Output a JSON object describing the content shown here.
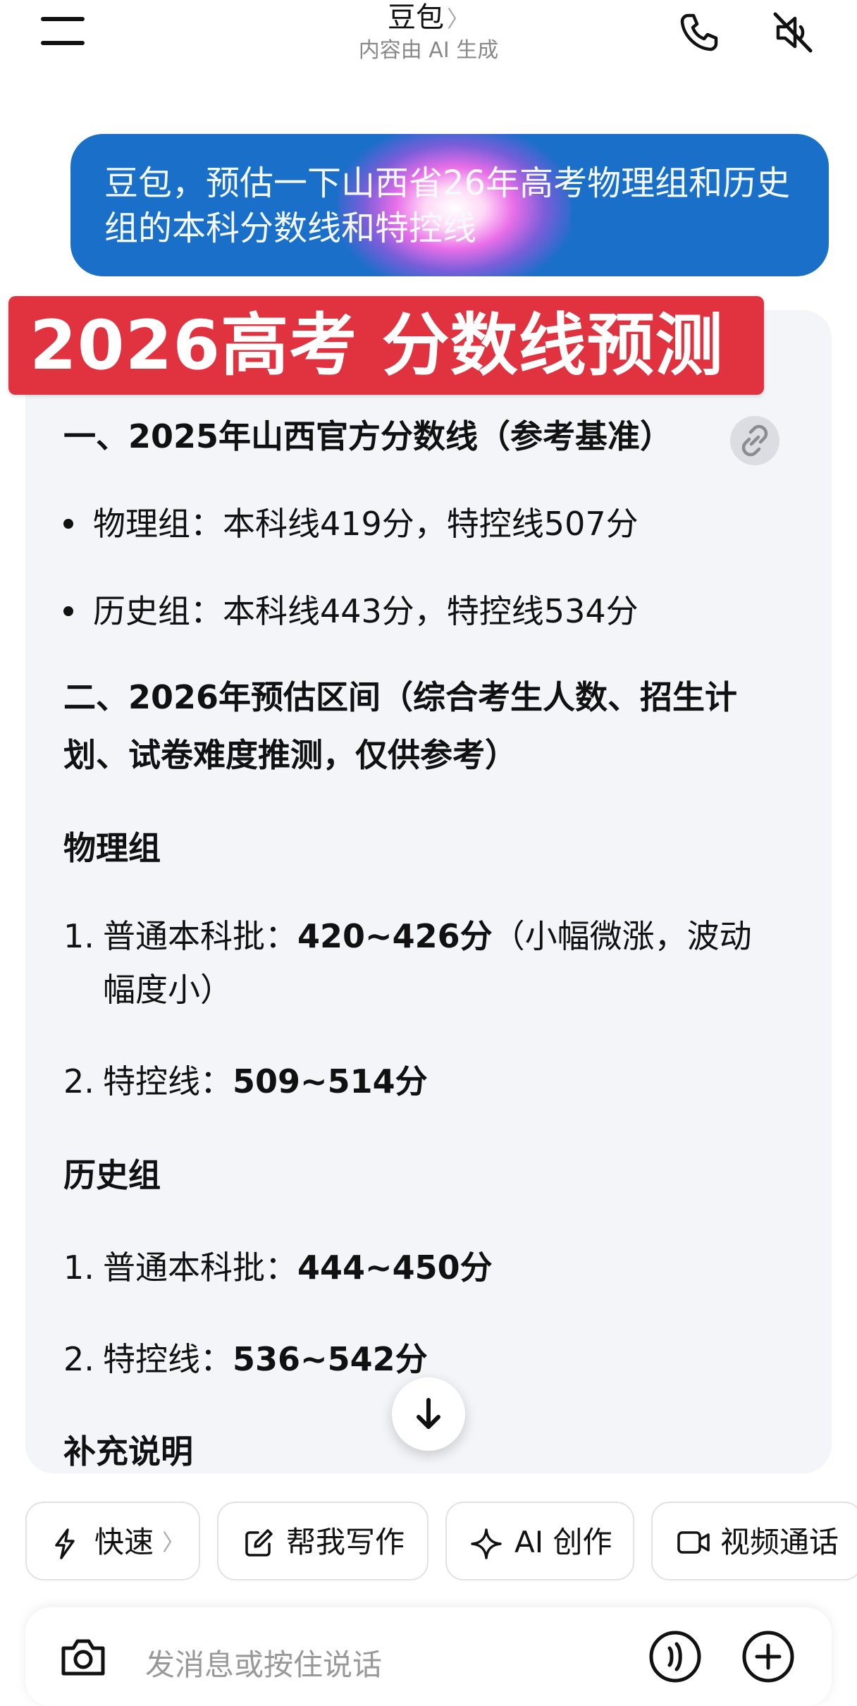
{
  "header": {
    "title": "豆包",
    "title_chevron": "〉",
    "subtitle": "内容由 AI 生成"
  },
  "user_message": {
    "text": "豆包，预估一下山西省26年高考物理组和历史组的本科分数线和特控线"
  },
  "banner": {
    "text": "2026高考  分数线预测"
  },
  "answer": {
    "section1_title": "一、2025年山西官方分数线（参考基准）",
    "bullets": [
      "物理组：本科线419分，特控线507分",
      "历史组：本科线443分，特控线534分"
    ],
    "section2_title": "二、2026年预估区间（综合考生人数、招生计划、试卷难度推测，仅供参考）",
    "physics": {
      "heading": "物理组",
      "items": [
        {
          "num": "1.",
          "label": "普通本科批：",
          "value": "420~426分",
          "note": "（小幅微涨，波动",
          "note2": "幅度小）"
        },
        {
          "num": "2.",
          "label": "特控线：",
          "value": "509~514分"
        }
      ]
    },
    "history": {
      "heading": "历史组",
      "items": [
        {
          "num": "1.",
          "label": "普通本科批：",
          "value": "444~450分"
        },
        {
          "num": "2.",
          "label": "特控线：",
          "value": "536~542分"
        }
      ]
    },
    "supplement_heading": "补充说明"
  },
  "chips": [
    {
      "label": "快速",
      "chevron": "〉",
      "icon": "lightning-icon"
    },
    {
      "label": "帮我写作",
      "icon": "edit-icon"
    },
    {
      "label": "AI 创作",
      "icon": "sparkle-icon"
    },
    {
      "label": "视频通话",
      "icon": "video-icon"
    }
  ],
  "input": {
    "placeholder": "发消息或按住说话"
  },
  "colors": {
    "user_bubble": "#1a6fc9",
    "banner": "#e0323f",
    "card_bg": "#f4f5f8"
  }
}
